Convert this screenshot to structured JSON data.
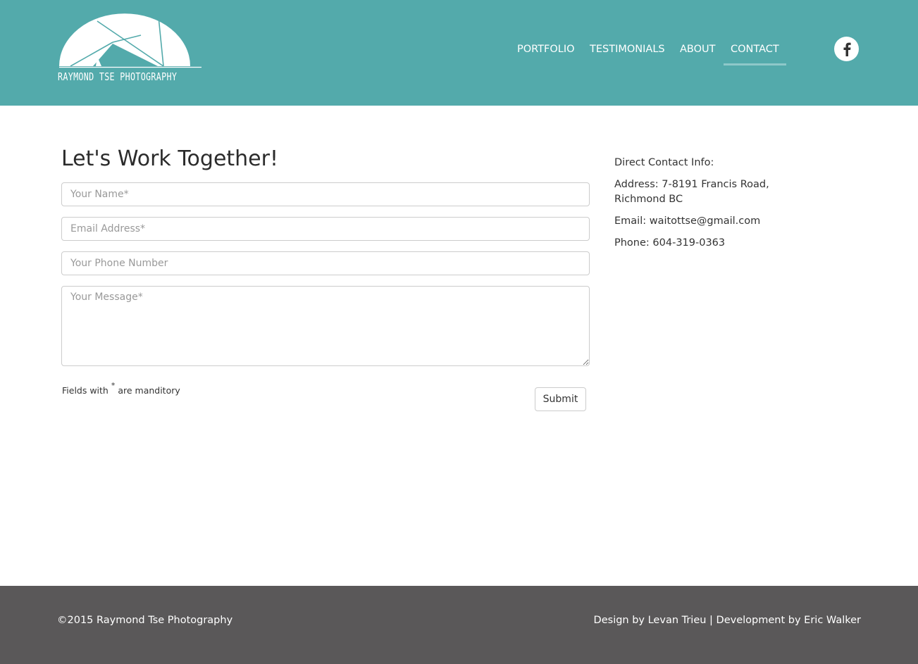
{
  "header": {
    "logo_text": "RAYMOND TSE PHOTOGRAPHY",
    "bg_color": "#53aaab",
    "nav": [
      {
        "label": "PORTFOLIO",
        "active": false
      },
      {
        "label": "TESTIMONIALS",
        "active": false
      },
      {
        "label": "ABOUT",
        "active": false
      },
      {
        "label": "CONTACT",
        "active": true
      }
    ],
    "social_icon": "facebook-icon"
  },
  "main": {
    "title": "Let's Work Together!",
    "form": {
      "name_placeholder": "Your Name*",
      "email_placeholder": "Email Address*",
      "phone_placeholder": "Your Phone Number",
      "message_placeholder": "Your Message*",
      "note_prefix": "Fields with",
      "note_asterisk": "*",
      "note_suffix": "are manditory",
      "submit_label": "Submit"
    },
    "contact": {
      "heading": "Direct Contact Info:",
      "address": "Address: 7-8191 Francis Road, Richmond BC",
      "email": "Email: waitottse@gmail.com",
      "phone": "Phone: 604-319-0363"
    }
  },
  "footer": {
    "copyright": "©2015 Raymond Tse Photography",
    "credits": "Design by Levan Trieu | Development by Eric Walker",
    "bg_color": "#5a5859"
  }
}
